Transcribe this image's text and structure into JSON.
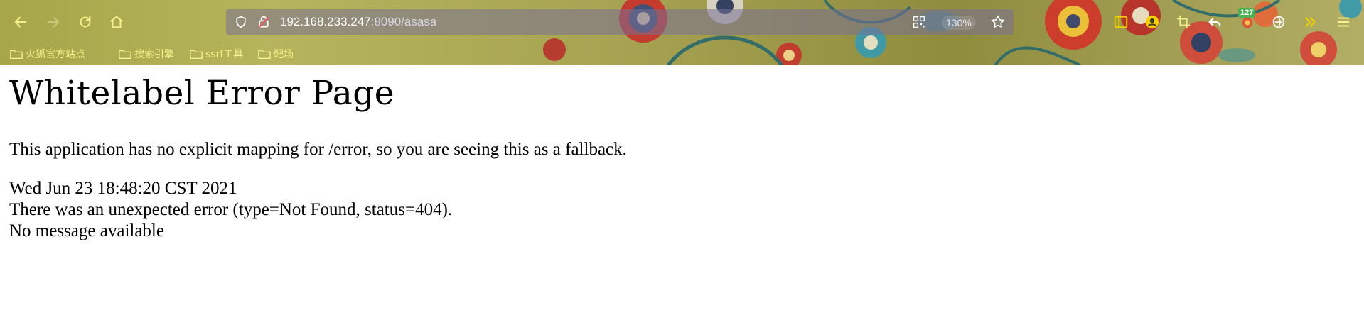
{
  "browser": {
    "url": {
      "host": "192.168.233.247",
      "rest": ":8090/asasa"
    },
    "zoom": "130%",
    "extension_badge": "127",
    "bookmarks": [
      {
        "label": "火狐官方站点"
      },
      {
        "label": "搜索引擎"
      },
      {
        "label": "ssrf工具"
      },
      {
        "label": "靶场"
      }
    ]
  },
  "page": {
    "title": "Whitelabel Error Page",
    "description": "This application has no explicit mapping for /error, so you are seeing this as a fallback.",
    "timestamp": "Wed Jun 23 18:48:20 CST 2021",
    "error": "There was an unexpected error (type=Not Found, status=404).",
    "message": "No message available"
  },
  "colors": {
    "toolbar_icon": "#f4f08a",
    "bookmark_text": "#f6f18a",
    "page_background": "#ffffff",
    "page_text": "#000000"
  }
}
